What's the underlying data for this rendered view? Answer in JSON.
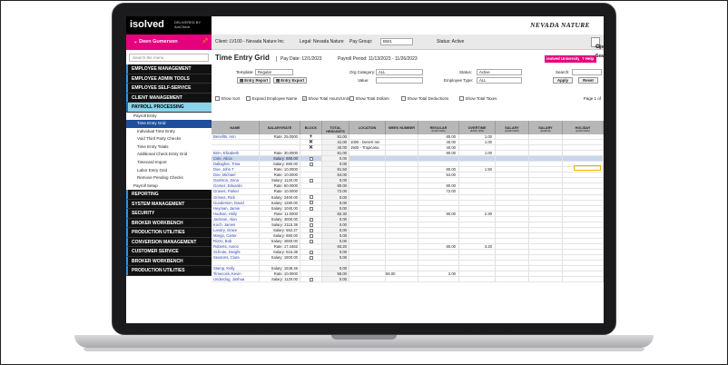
{
  "brand": {
    "logo": "isolved",
    "delivered": "DELIVERED BY",
    "company": "AmCheck",
    "client_brand": "NEVADA NATURE"
  },
  "user": {
    "name": "Deen Gumerson",
    "chevron": "chevron-down-icon",
    "pin": "pin-icon"
  },
  "search_menu": {
    "placeholder": "Search the menu"
  },
  "nav": {
    "top_items": [
      "EMPLOYEE MANAGEMENT",
      "EMPLOYEE ADMIN TOOLS",
      "EMPLOYEE SELF-SERVICE",
      "CLIENT MANAGEMENT",
      "PAYROLL PROCESSING"
    ],
    "payroll_entry": "Payroll Entry",
    "sub_items": [
      "Time Entry Grid",
      "Individual Time Entry",
      "Void Third Party Checks",
      "Time Entry Totals",
      "Additional Check Entry Grid",
      "Timecard Import",
      "Labor Entry Grid",
      "Remove Pending Checks"
    ],
    "payroll_setup": "Payroll Setup",
    "bottom_items": [
      "REPORTING",
      "SYSTEM MANAGEMENT",
      "SECURITY",
      "BROKER WORKBENCH",
      "PRODUCTION UTILITIES",
      "CONVERSION MANAGEMENT",
      "CUSTOMER SERVICE",
      "BROKER WORKBENCH",
      "PRODUCTION UTILITIES"
    ]
  },
  "topbar": {
    "client": "Client: LV100 - Nevada Nature Inc",
    "legal": "Legal: Nevada Nature",
    "pay_group_label": "Pay Group:",
    "pay_group_value": "BW1",
    "status": "Status: Active",
    "client_search": "Client Search"
  },
  "page": {
    "title": "Time Entry Grid",
    "pay_date": "Pay Date: 12/1/2023",
    "period": "Payroll Period: 11/13/2023 - 11/26/2023",
    "university": "isolved University",
    "help": "Help"
  },
  "filters": {
    "template_label": "Template:",
    "template_value": "Regular",
    "org_label": "Org Category:",
    "org_value": "ALL",
    "status_label": "Status:",
    "status_value": "Active",
    "search_label": "Search:",
    "value_label": "Value:",
    "emp_type_label": "Employee Type:",
    "emp_type_value": "ALL",
    "entry_report": "Entry Report",
    "entry_export": "Entry Export",
    "apply": "Apply",
    "reset": "Reset"
  },
  "checkboxes": [
    {
      "label": "Show Sort",
      "checked": false
    },
    {
      "label": "Expand Employee Name",
      "checked": false
    },
    {
      "label": "Show Total Hours/Units",
      "checked": true
    },
    {
      "label": "Show Total Dollars",
      "checked": false
    },
    {
      "label": "Show Total Deductions",
      "checked": false
    },
    {
      "label": "Show Total Taxes",
      "checked": false
    }
  ],
  "page_of": "Page 1 of",
  "columns": [
    {
      "label": "NAME",
      "sub": ""
    },
    {
      "label": "SALARY/RATE",
      "sub": ""
    },
    {
      "label": "BLOCK",
      "sub": ""
    },
    {
      "label": "TOTAL HRS/UNITS",
      "sub": ""
    },
    {
      "label": "LOCATION",
      "sub": ""
    },
    {
      "label": "WEEK NUMBER",
      "sub": ""
    },
    {
      "label": "REGULAR",
      "sub": "(EARN HRS)"
    },
    {
      "label": "OVERTIME",
      "sub": "(EARN HRS)"
    },
    {
      "label": "SALARY",
      "sub": "(EARN HRS)"
    },
    {
      "label": "SALARY",
      "sub": "(EARN $)"
    },
    {
      "label": "HOLIDAY",
      "sub": "(EARN HRS)"
    }
  ],
  "rows": [
    {
      "name": "Benefits, Ann",
      "sal": "Rate: 25.0000",
      "blk": "plus",
      "hrs": "81.00",
      "loc": "",
      "reg": "80.00",
      "ot": "1.00",
      "hl": false
    },
    {
      "name": "",
      "sal": "",
      "blk": "x",
      "hrs": "41.00",
      "loc": "1000 - Desert Inn",
      "reg": "40.00",
      "ot": "1.00",
      "hl": false
    },
    {
      "name": "",
      "sal": "",
      "blk": "x",
      "hrs": "40.00",
      "loc": "1500 - Tropicana",
      "reg": "40.00",
      "ot": "",
      "hl": false
    },
    {
      "name": "Brim, Elizabeth",
      "sal": "Rate: 30.0000",
      "blk": "",
      "hrs": "81.00",
      "loc": "",
      "reg": "80.00",
      "ot": "1.00",
      "hl": false
    },
    {
      "name": "Cole, Alicia",
      "sal": "Salary: 880.00",
      "blk": "box",
      "hrs": "0.00",
      "loc": "",
      "reg": "",
      "ot": "",
      "hl": true
    },
    {
      "name": "Dallagher, Trina",
      "sal": "Salary: 880.00",
      "blk": "box",
      "hrs": "0.00",
      "loc": "",
      "reg": "",
      "ot": "",
      "hl": false
    },
    {
      "name": "Doe, John T",
      "sal": "Rate: 10.0000",
      "blk": "",
      "hrs": "81.50",
      "loc": "",
      "reg": "80.00",
      "ot": "1.50",
      "hl": false
    },
    {
      "name": "Doe, Michael",
      "sal": "Rate: 10.0000",
      "blk": "",
      "hrs": "54.00",
      "loc": "",
      "reg": "54.00",
      "ot": "",
      "hl": false
    },
    {
      "name": "Garrison, Zena",
      "sal": "Salary: 1120.00",
      "blk": "box",
      "hrs": "0.00",
      "loc": "",
      "reg": "",
      "ot": "",
      "hl": false
    },
    {
      "name": "Gomez, Eduardo",
      "sal": "Rate: 60.0000",
      "blk": "",
      "hrs": "80.00",
      "loc": "",
      "reg": "80.00",
      "ot": "",
      "hl": false
    },
    {
      "name": "Graves, Parker",
      "sal": "Rate: 10.0000",
      "blk": "",
      "hrs": "72.00",
      "loc": "",
      "reg": "72.00",
      "ot": "",
      "hl": false
    },
    {
      "name": "Grimes, Rick",
      "sal": "Salary: 2400.00",
      "blk": "box",
      "hrs": "0.00",
      "loc": "",
      "reg": "",
      "ot": "",
      "hl": false
    },
    {
      "name": "Gunderson, David",
      "sal": "Salary: 1280.00",
      "blk": "box",
      "hrs": "0.00",
      "loc": "",
      "reg": "",
      "ot": "",
      "hl": false
    },
    {
      "name": "Heyman, Jamie",
      "sal": "Salary: 1040.00",
      "blk": "box",
      "hrs": "0.00",
      "loc": "",
      "reg": "",
      "ot": "",
      "hl": false
    },
    {
      "name": "Hudson, Holly",
      "sal": "Rate: 11.0000",
      "blk": "",
      "hrs": "82.30",
      "loc": "",
      "reg": "80.00",
      "ot": "2.30",
      "hl": false
    },
    {
      "name": "Jackson, Alan",
      "sal": "Salary: 4000.00",
      "blk": "box",
      "hrs": "0.00",
      "loc": "",
      "reg": "",
      "ot": "",
      "hl": false
    },
    {
      "name": "Koch, James",
      "sal": "Salary: 2115.38",
      "blk": "box",
      "hrs": "0.00",
      "loc": "",
      "reg": "",
      "ot": "",
      "hl": false
    },
    {
      "name": "Landry, Grace",
      "sal": "Salary: 562.27",
      "blk": "box",
      "hrs": "0.00",
      "loc": "",
      "reg": "",
      "ot": "",
      "hl": false
    },
    {
      "name": "Margo, Carter",
      "sal": "Salary: 880.00",
      "blk": "box",
      "hrs": "0.00",
      "loc": "",
      "reg": "",
      "ot": "",
      "hl": false
    },
    {
      "name": "Rizzo, Bob",
      "sal": "Salary: 2650.00",
      "blk": "box",
      "hrs": "0.00",
      "loc": "",
      "reg": "",
      "ot": "",
      "hl": false
    },
    {
      "name": "Roberts, Aaron",
      "sal": "Rate: 17.4462",
      "blk": "",
      "hrs": "83.20",
      "loc": "",
      "reg": "80.00",
      "ot": "3.20",
      "hl": false
    },
    {
      "name": "Schrute, Dwight",
      "sal": "Salary: 615.38",
      "blk": "box",
      "hrs": "0.00",
      "loc": "",
      "reg": "",
      "ot": "",
      "hl": false
    },
    {
      "name": "Seasons, Clara",
      "sal": "Salary: 1600.00",
      "blk": "box",
      "hrs": "0.00",
      "loc": "",
      "reg": "",
      "ot": "",
      "hl": false
    },
    {
      "name": "",
      "sal": "",
      "blk": "",
      "hrs": "",
      "loc": "",
      "reg": "",
      "ot": "",
      "hl": false
    },
    {
      "name": "Stamp, Kelly",
      "sal": "Salary: 1538.46",
      "blk": "",
      "hrs": "0.00",
      "loc": "",
      "reg": "",
      "ot": "",
      "hl": false
    },
    {
      "name": "Timecock, Kevin",
      "sal": "Rate: 10.0000",
      "blk": "",
      "hrs": "58.00",
      "loc": "",
      "wk": "56.00",
      "reg": "2.00",
      "ot": "",
      "hl": false
    },
    {
      "name": "Underdog, Joshua",
      "sal": "Salary: 1120.00",
      "blk": "box",
      "hrs": "0.00",
      "loc": "",
      "reg": "",
      "ot": "",
      "hl": false
    }
  ],
  "colors": {
    "accent": "#e5007d",
    "nav_bg": "#111111",
    "active_nav": "#8ad3ea",
    "selected_sub": "#1f4f9c",
    "link": "#2a3fb0"
  }
}
